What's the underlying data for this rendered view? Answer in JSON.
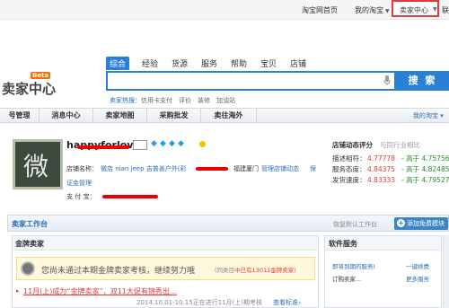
{
  "topbar": {
    "links": [
      "淘宝网首页",
      "我的淘宝",
      "卖家中心",
      "联"
    ],
    "seller_center": "卖家中心"
  },
  "logo": {
    "text": "卖家中心",
    "badge": "Beta"
  },
  "search": {
    "tabs": [
      "综合",
      "经验",
      "货源",
      "服务",
      "帮助",
      "宝贝",
      "店铺"
    ],
    "active_tab": "综合",
    "button_label": "搜 索",
    "hot_label": "卖家热搜：",
    "hot_words": [
      "信用卡支付",
      "评价",
      "装修",
      "加油站"
    ]
  },
  "nav": {
    "items": [
      "号管理",
      "消息中心",
      "卖家地图",
      "采购批发",
      "卖往海外"
    ],
    "my_taobao": "我的淘宝"
  },
  "profile": {
    "nickname": "happyforlove",
    "avatar_glyph": "微",
    "shop_name_label": "店铺名称：",
    "shop_name_value": "微店 nian jeep 吉普善户外(彩",
    "location": "福建厦门",
    "manage_link": "管理店铺动态",
    "cert_link_a": "保",
    "cert_link_b": "证金管理",
    "alipay_label": "支 付 宝：",
    "dsr_title": "店铺动态评分",
    "dsr_subtitle": "与同行业相比",
    "dsr": [
      {
        "label": "描述相符：",
        "score": "4.77778",
        "compare": "- 高于 4.75756"
      },
      {
        "label": "服务态度：",
        "score": "4.84375",
        "compare": "- 高于 4.82485"
      },
      {
        "label": "发货速度：",
        "score": "4.83333",
        "compare": "- 高于 4.79527"
      }
    ]
  },
  "workspace": {
    "title": "卖家工作台",
    "set_default": "恢复默认工作台",
    "add_module": "添加免费模块"
  },
  "gold": {
    "title": "金牌卖家",
    "notice": "您尚未通过本期金牌卖家考核，继续努力哦",
    "notice_sub_prefix": "(同类目",
    "notice_sub_highlight": "中已有13011金牌卖家",
    "notice_sub_suffix": ")",
    "news_link": "11月(上)成为“金牌卖家”，双11大促有锦秀出…",
    "news_date": "2014.10.01-10.15正在进行11月(上)期考核",
    "more": "查看标准›"
  },
  "software": {
    "title": "软件服务",
    "row1_left": "即将到期的服务(",
    "row1_right": "一键续费",
    "row2_left": "订购卖家...",
    "row2_right": "更多服务"
  },
  "colors": {
    "accent": "#2a80d5",
    "highlight_red": "#e4393c",
    "compare_green": "#2a8a2a"
  }
}
